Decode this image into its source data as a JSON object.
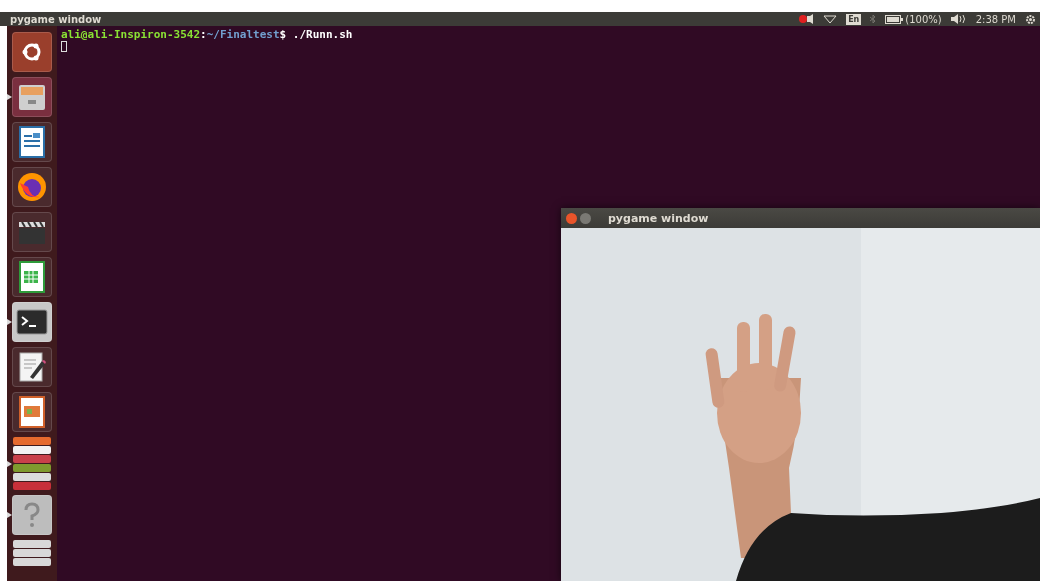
{
  "top_panel": {
    "title": "pygame window",
    "language": "En",
    "battery": "(100%)",
    "time": "2:38 PM"
  },
  "launcher": {
    "items": [
      {
        "kind": "ubuntu",
        "running": false
      },
      {
        "kind": "files",
        "running": true
      },
      {
        "kind": "writer",
        "running": false
      },
      {
        "kind": "firefox",
        "running": false
      },
      {
        "kind": "video",
        "running": false
      },
      {
        "kind": "calc",
        "running": false
      },
      {
        "kind": "terminal",
        "running": true
      },
      {
        "kind": "editor",
        "running": false
      },
      {
        "kind": "impress",
        "running": false
      },
      {
        "kind": "stack",
        "running": true
      },
      {
        "kind": "help",
        "running": true
      },
      {
        "kind": "stack",
        "running": false
      }
    ]
  },
  "terminal": {
    "user": "ali@ali-Inspiron-3542",
    "separator": ":",
    "path": "~/Finaltest",
    "prompt_symbol": "$",
    "command": "./Runn.sh"
  },
  "pygame_window": {
    "title": "pygame window"
  }
}
